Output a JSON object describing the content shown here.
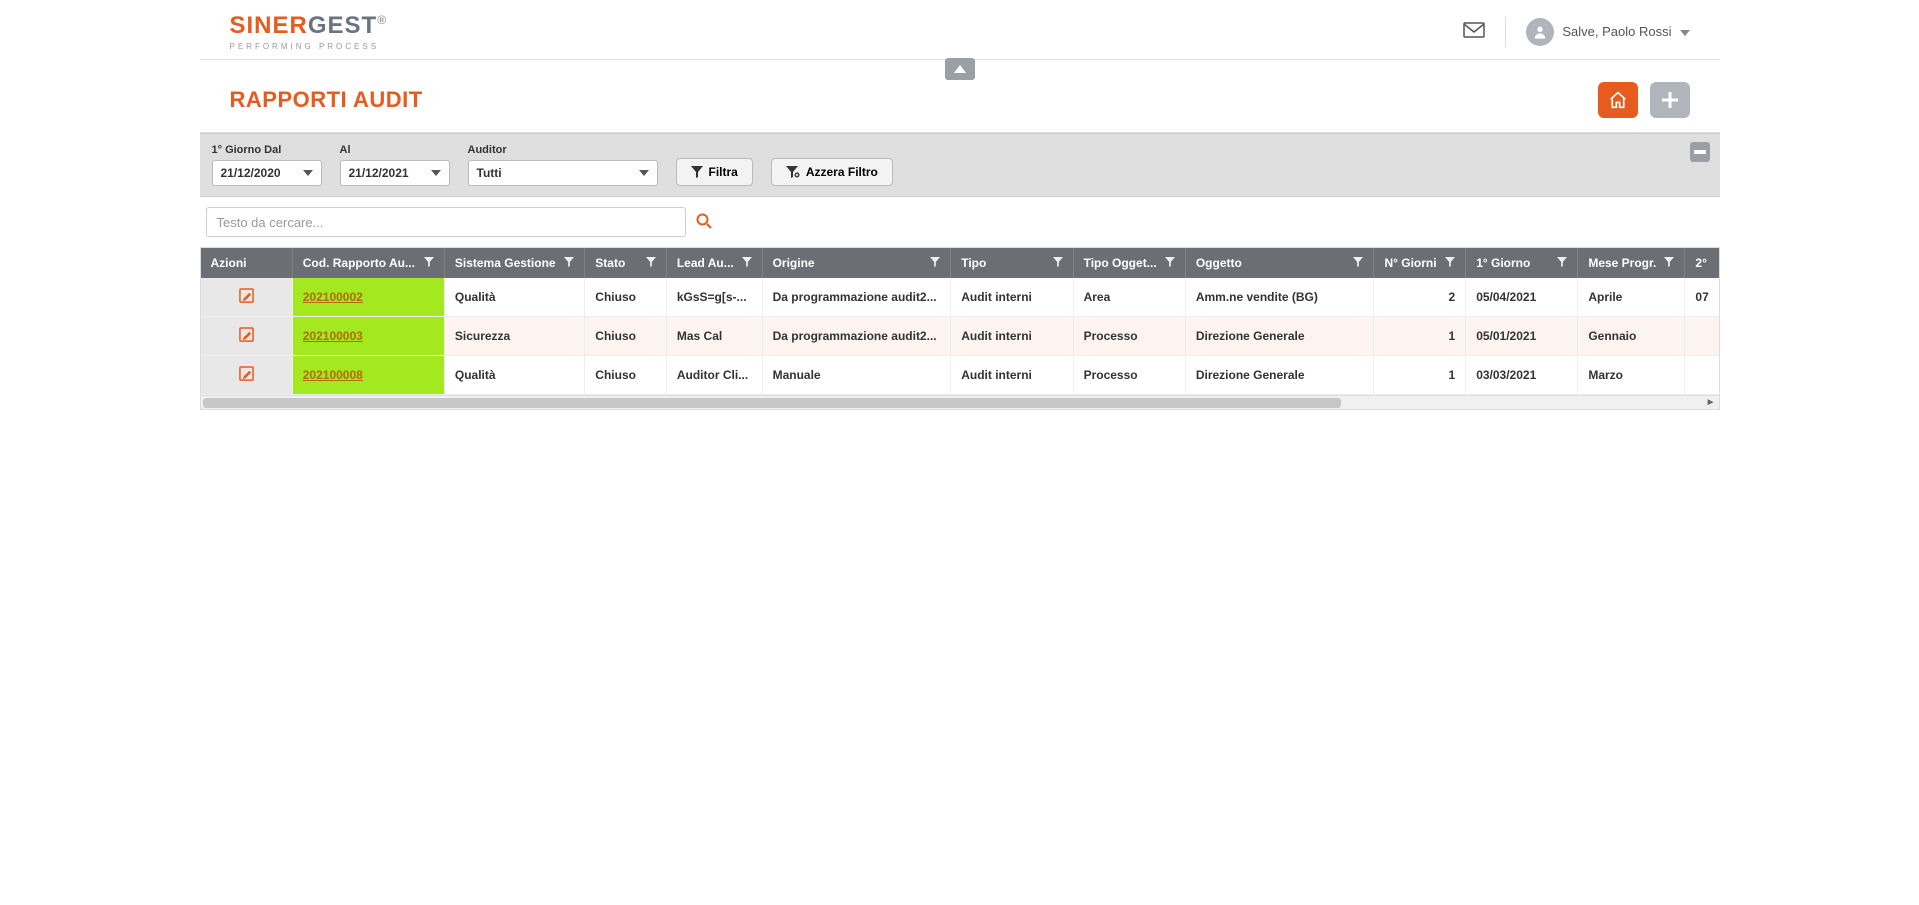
{
  "header": {
    "brand_a": "SINER",
    "brand_b": "GEST",
    "brand_sub": "PERFORMING PROCESS",
    "greeting": "Salve, Paolo Rossi"
  },
  "page": {
    "title": "RAPPORTI AUDIT"
  },
  "filters": {
    "date_from_label": "1° Giorno Dal",
    "date_from_value": "21/12/2020",
    "date_to_label": "Al",
    "date_to_value": "21/12/2021",
    "auditor_label": "Auditor",
    "auditor_value": "Tutti",
    "btn_filter": "Filtra",
    "btn_clear": "Azzera Filtro"
  },
  "search": {
    "placeholder": "Testo da cercare..."
  },
  "columns": {
    "azioni": "Azioni",
    "cod": "Cod. Rapporto Au...",
    "sistema": "Sistema Gestione",
    "stato": "Stato",
    "lead": "Lead Au...",
    "origine": "Origine",
    "tipo": "Tipo",
    "tipo_ogg": "Tipo Ogget...",
    "oggetto": "Oggetto",
    "ngiorni": "N° Giorni",
    "primo": "1° Giorno",
    "mese": "Mese Progr.",
    "secondo": "2°"
  },
  "rows": [
    {
      "cod": "202100002",
      "sistema": "Qualità",
      "stato": "Chiuso",
      "lead": "kGsS=g[s-...",
      "origine": "Da programmazione audit2...",
      "tipo": "Audit interni",
      "tipo_ogg": "Area",
      "oggetto": "Amm.ne vendite (BG)",
      "ngiorni": "2",
      "primo": "05/04/2021",
      "mese": "Aprile",
      "secondo": "07"
    },
    {
      "cod": "202100003",
      "sistema": "Sicurezza",
      "stato": "Chiuso",
      "lead": "Mas Cal",
      "origine": "Da programmazione audit2...",
      "tipo": "Audit interni",
      "tipo_ogg": "Processo",
      "oggetto": "Direzione Generale",
      "ngiorni": "1",
      "primo": "05/01/2021",
      "mese": "Gennaio",
      "secondo": ""
    },
    {
      "cod": "202100008",
      "sistema": "Qualità",
      "stato": "Chiuso",
      "lead": "Auditor Cli...",
      "origine": "Manuale",
      "tipo": "Audit interni",
      "tipo_ogg": "Processo",
      "oggetto": "Direzione Generale",
      "ngiorni": "1",
      "primo": "03/03/2021",
      "mese": "Marzo",
      "secondo": ""
    }
  ]
}
